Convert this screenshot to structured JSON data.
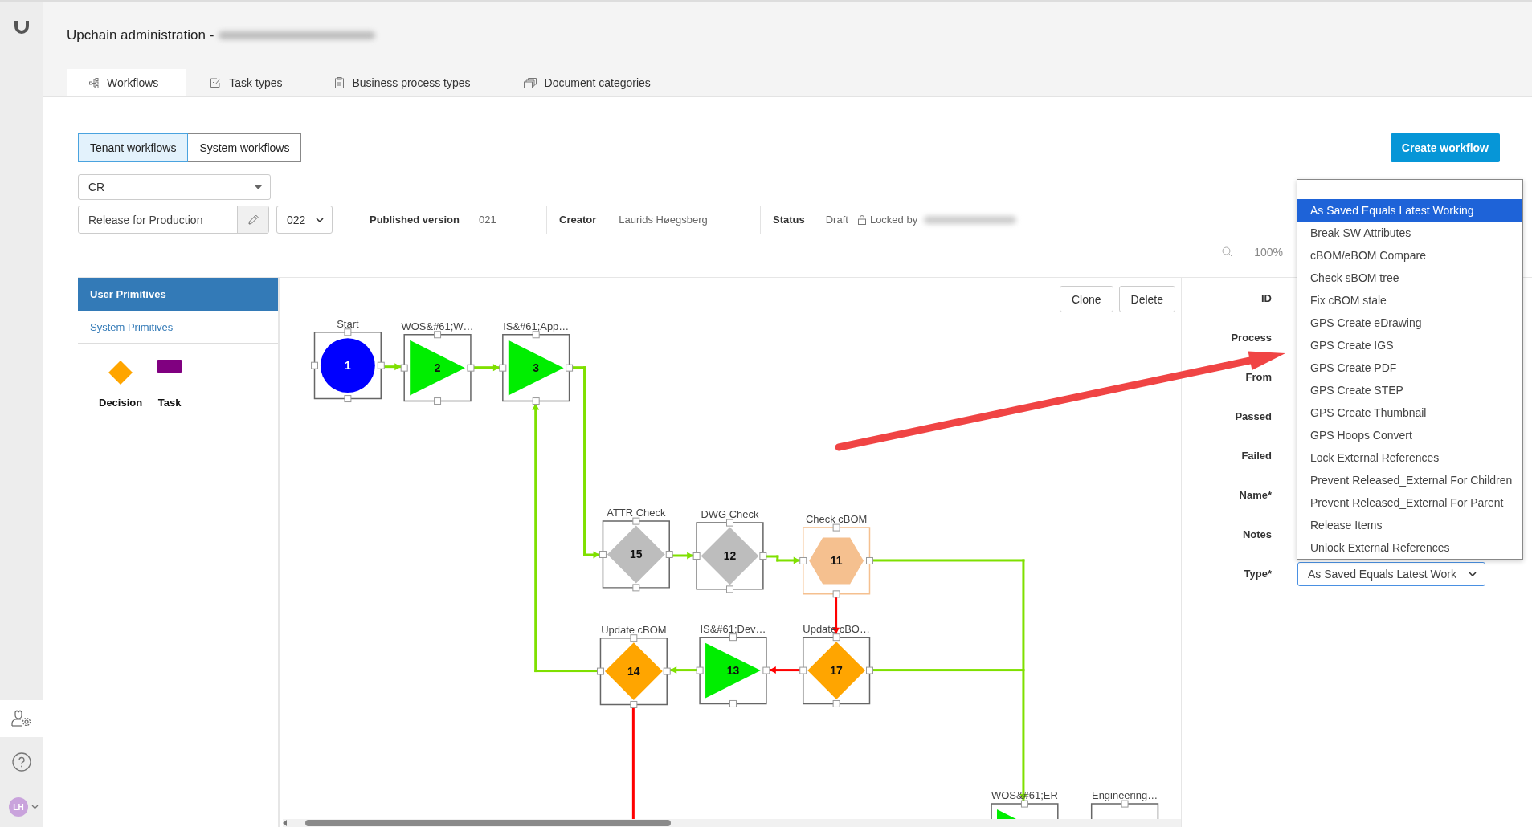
{
  "header": {
    "title": "Upchain administration -"
  },
  "tabs": [
    {
      "label": "Workflows",
      "selected": true
    },
    {
      "label": "Task types",
      "selected": false
    },
    {
      "label": "Business process types",
      "selected": false
    },
    {
      "label": "Document categories",
      "selected": false
    }
  ],
  "workflow_scope": [
    {
      "label": "Tenant workflows",
      "selected": true
    },
    {
      "label": "System workflows",
      "selected": false
    }
  ],
  "create_button": "Create workflow",
  "category_select": {
    "value": "CR"
  },
  "workflow_name": {
    "value": "Release for Production"
  },
  "version_select": {
    "value": "022"
  },
  "info": [
    {
      "label": "Published version",
      "value": "021"
    },
    {
      "label": "Creator",
      "value": "Laurids Høegsberg"
    },
    {
      "label": "Status",
      "value": "Draft"
    }
  ],
  "lock": {
    "label": "Locked by"
  },
  "zoom": "100%",
  "primitives": {
    "tabs": [
      {
        "label": "User Primitives",
        "selected": true
      },
      {
        "label": "System Primitives",
        "selected": false
      }
    ],
    "items": [
      {
        "label": "Decision",
        "kind": "decision",
        "color": "#ffa500"
      },
      {
        "label": "Task",
        "kind": "task",
        "color": "#800080"
      }
    ]
  },
  "canvas_buttons": [
    "Clone",
    "Delete"
  ],
  "nodes": [
    {
      "label": "Start",
      "number": "1",
      "kind": "circle",
      "color": "#0000ff",
      "selected": false
    },
    {
      "label": "WOS&#61;W…",
      "number": "2",
      "kind": "triangle",
      "color": "#00ee00",
      "selected": false
    },
    {
      "label": "IS&#61;App…",
      "number": "3",
      "kind": "triangle",
      "color": "#00ee00",
      "selected": false
    },
    {
      "label": "ATTR Check",
      "number": "15",
      "kind": "diamond",
      "color": "#bdbdbd",
      "selected": false
    },
    {
      "label": "DWG Check",
      "number": "12",
      "kind": "diamond",
      "color": "#bdbdbd",
      "selected": false
    },
    {
      "label": "Check cBOM",
      "number": "11",
      "kind": "hexagon",
      "color": "#f5c08f",
      "selected": true
    },
    {
      "label": "Update cBOM",
      "number": "14",
      "kind": "diamond",
      "color": "#ffa500",
      "selected": false
    },
    {
      "label": "IS&#61;Dev…",
      "number": "13",
      "kind": "triangle",
      "color": "#00ee00",
      "selected": false
    },
    {
      "label": "Update cBO…",
      "number": "17",
      "kind": "diamond",
      "color": "#ffa500",
      "selected": false
    },
    {
      "label": "WOS&#61;ER",
      "kind": "triangle",
      "color": "#00ee00",
      "selected": false
    },
    {
      "label": "Engineering…",
      "selected": false
    }
  ],
  "edges": [
    {
      "color": "#7fe000"
    },
    {
      "color": "#7fe000"
    },
    {
      "color": "#7fe000"
    },
    {
      "color": "#7fe000"
    },
    {
      "color": "#7fe000"
    },
    {
      "color": "#7fe000"
    },
    {
      "color": "#7fe000"
    },
    {
      "color": "#ff0000"
    },
    {
      "color": "#ff0000"
    },
    {
      "color": "#7fe000"
    },
    {
      "color": "#7fe000"
    },
    {
      "color": "#ff0000"
    }
  ],
  "properties": {
    "labels": [
      "ID",
      "Process",
      "From",
      "Passed",
      "Failed",
      "Name*",
      "Notes",
      "Type*"
    ],
    "type_select": {
      "value": "As Saved Equals Latest Work"
    }
  },
  "type_options": [
    {
      "label": "As Saved Equals Latest Working",
      "selected": true
    },
    {
      "label": "Break SW Attributes",
      "selected": false
    },
    {
      "label": "cBOM/eBOM Compare",
      "selected": false
    },
    {
      "label": "Check sBOM tree",
      "selected": false
    },
    {
      "label": "Fix cBOM stale",
      "selected": false
    },
    {
      "label": "GPS Create eDrawing",
      "selected": false
    },
    {
      "label": "GPS Create IGS",
      "selected": false
    },
    {
      "label": "GPS Create PDF",
      "selected": false
    },
    {
      "label": "GPS Create STEP",
      "selected": false
    },
    {
      "label": "GPS Create Thumbnail",
      "selected": false
    },
    {
      "label": "GPS Hoops Convert",
      "selected": false
    },
    {
      "label": "Lock External References",
      "selected": false
    },
    {
      "label": "Prevent Released_External For Children",
      "selected": false
    },
    {
      "label": "Prevent Released_External For Parent",
      "selected": false
    },
    {
      "label": "Release Items",
      "selected": false
    },
    {
      "label": "Unlock External References",
      "selected": false
    }
  ],
  "user": {
    "initials": "LH"
  }
}
